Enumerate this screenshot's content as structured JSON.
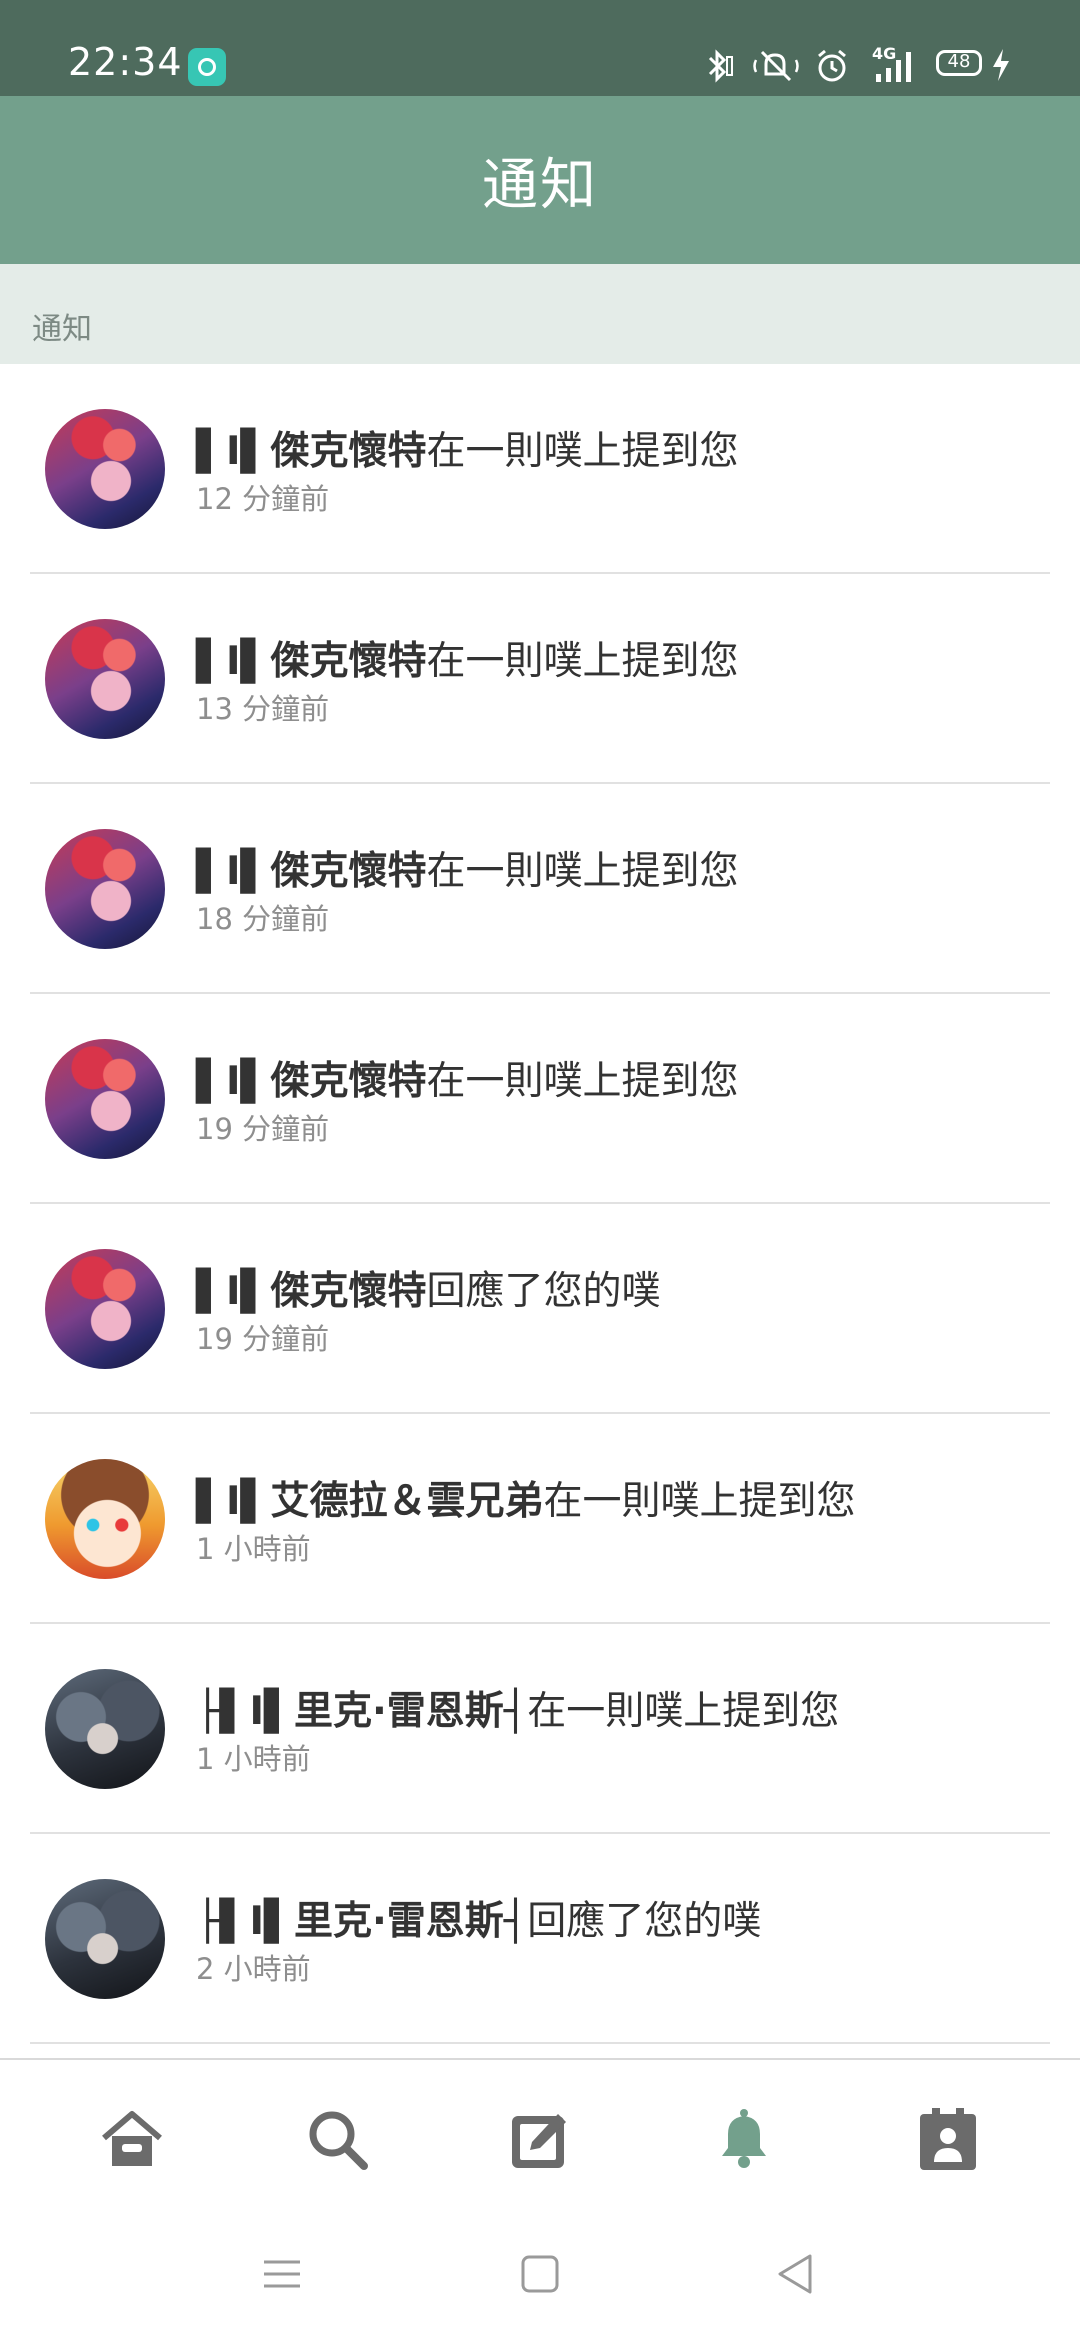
{
  "status_bar": {
    "time": "22:34",
    "battery": "48",
    "network": "4G",
    "icons": [
      "app-icon",
      "bluetooth-icon",
      "mute-icon",
      "alarm-icon",
      "signal-icon",
      "battery-icon",
      "charging-icon"
    ]
  },
  "header": {
    "title": "通知"
  },
  "section": {
    "label": "通知"
  },
  "notifications": [
    {
      "prefix": "▌I▌",
      "name": "傑克懷特",
      "action": "在一則噗上提到您",
      "time": "12 分鐘前",
      "avatar": "red"
    },
    {
      "prefix": "▌I▌",
      "name": "傑克懷特",
      "action": "在一則噗上提到您",
      "time": "13 分鐘前",
      "avatar": "red"
    },
    {
      "prefix": "▌I▌",
      "name": "傑克懷特",
      "action": "在一則噗上提到您",
      "time": "18 分鐘前",
      "avatar": "red"
    },
    {
      "prefix": "▌I▌",
      "name": "傑克懷特",
      "action": "在一則噗上提到您",
      "time": "19 分鐘前",
      "avatar": "red"
    },
    {
      "prefix": "▌I▌",
      "name": "傑克懷特",
      "action": "回應了您的噗",
      "time": "19 分鐘前",
      "avatar": "red"
    },
    {
      "prefix": "▌I▌",
      "name": "艾德拉＆雲兄弟",
      "action": "在一則噗上提到您",
      "time": "1 小時前",
      "avatar": "girl"
    },
    {
      "prefix": "├▌I▌",
      "name": "里克·雷恩斯",
      "suffix": "┤",
      "action": "在一則噗上提到您",
      "time": "1 小時前",
      "avatar": "dark"
    },
    {
      "prefix": "├▌I▌",
      "name": "里克·雷恩斯",
      "suffix": "┤",
      "action": "回應了您的噗",
      "time": "2 小時前",
      "avatar": "dark"
    }
  ],
  "bottom_nav": {
    "items": [
      "home-icon",
      "search-icon",
      "compose-icon",
      "bell-icon",
      "profile-card-icon"
    ],
    "active": "bell-icon",
    "active_color": "#73a08c",
    "inactive_color": "#6b6b6b"
  },
  "system_nav": [
    "menu-icon",
    "home-square-icon",
    "back-triangle-icon"
  ]
}
